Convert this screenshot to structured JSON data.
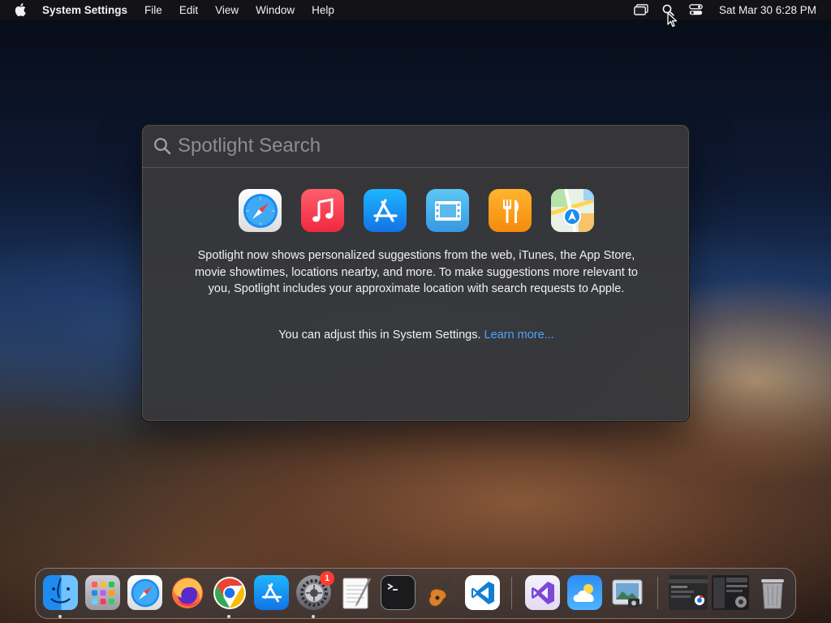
{
  "menubar": {
    "app_name": "System Settings",
    "menus": [
      "File",
      "Edit",
      "View",
      "Window",
      "Help"
    ],
    "clock": "Sat Mar 30  6:28 PM"
  },
  "spotlight": {
    "search_placeholder": "Spotlight Search",
    "suggestion_icons": [
      "safari-icon",
      "music-icon",
      "app-store-icon",
      "movies-icon",
      "restaurants-icon",
      "maps-icon"
    ],
    "description": "Spotlight now shows personalized suggestions from the web, iTunes, the App Store, movie showtimes, locations nearby, and more. To make suggestions more relevant to you, Spotlight includes your approximate location with search requests to Apple.",
    "adjust_text": "You can adjust this in System Settings.",
    "learn_more": "Learn more..."
  },
  "dock": {
    "apps": [
      "finder",
      "launchpad",
      "safari",
      "firefox",
      "chrome",
      "app-store",
      "system-settings",
      "textedit",
      "terminal",
      "garageband",
      "vscode",
      "visual-studio",
      "weather",
      "preview",
      "chrome-window-thumbnail",
      "activity-window-thumbnail",
      "trash"
    ],
    "settings_badge": "1"
  },
  "colors": {
    "link": "#4da3ff",
    "panel": "#38383a",
    "badge": "#ff3b30"
  }
}
